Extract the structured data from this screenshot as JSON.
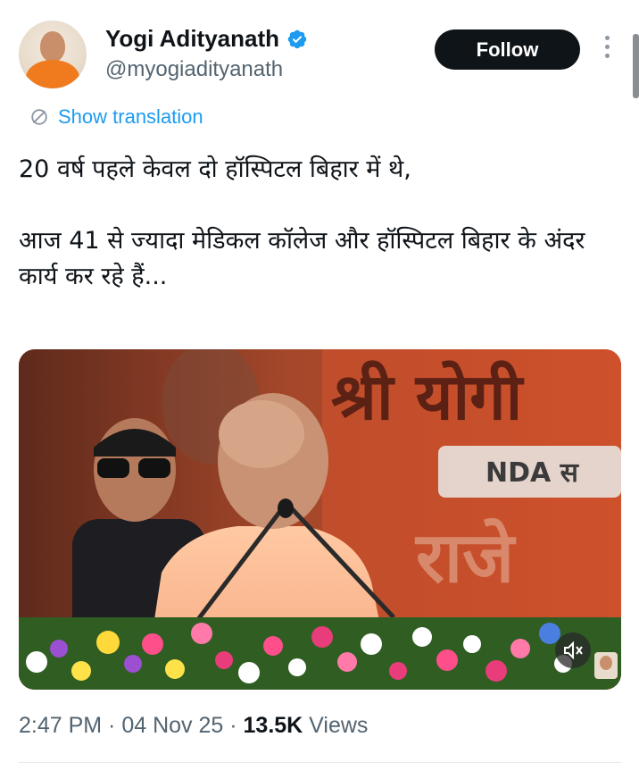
{
  "author": {
    "name": "Yogi Adityanath",
    "handle": "@myogiadityanath",
    "verified": true
  },
  "actions": {
    "follow_label": "Follow",
    "more_icon": "more-vertical-icon"
  },
  "translation": {
    "label": "Show translation",
    "icon": "translate-icon"
  },
  "tweet": {
    "paragraphs": [
      "20 वर्ष पहले केवल दो हॉस्पिटल बिहार में थे,",
      "आज 41 से ज्यादा मेडिकल कॉलेज और हॉस्पिटल बिहार के अंदर कार्य कर रहे हैं..."
    ]
  },
  "media": {
    "type": "video",
    "banner_text_top": "श्री योगी",
    "banner_text_badge": "NDA स",
    "banner_text_bottom": "राजे",
    "mute_icon": "muted-speaker-icon"
  },
  "meta": {
    "time": "2:47 PM",
    "separator1": " · ",
    "date": "04 Nov 25",
    "separator2": " · ",
    "views_count": "13.5K",
    "views_label": " Views"
  },
  "colors": {
    "accent": "#1d9bf0",
    "text": "#0f1419",
    "secondary": "#536471",
    "follow_bg": "#0f1419"
  }
}
